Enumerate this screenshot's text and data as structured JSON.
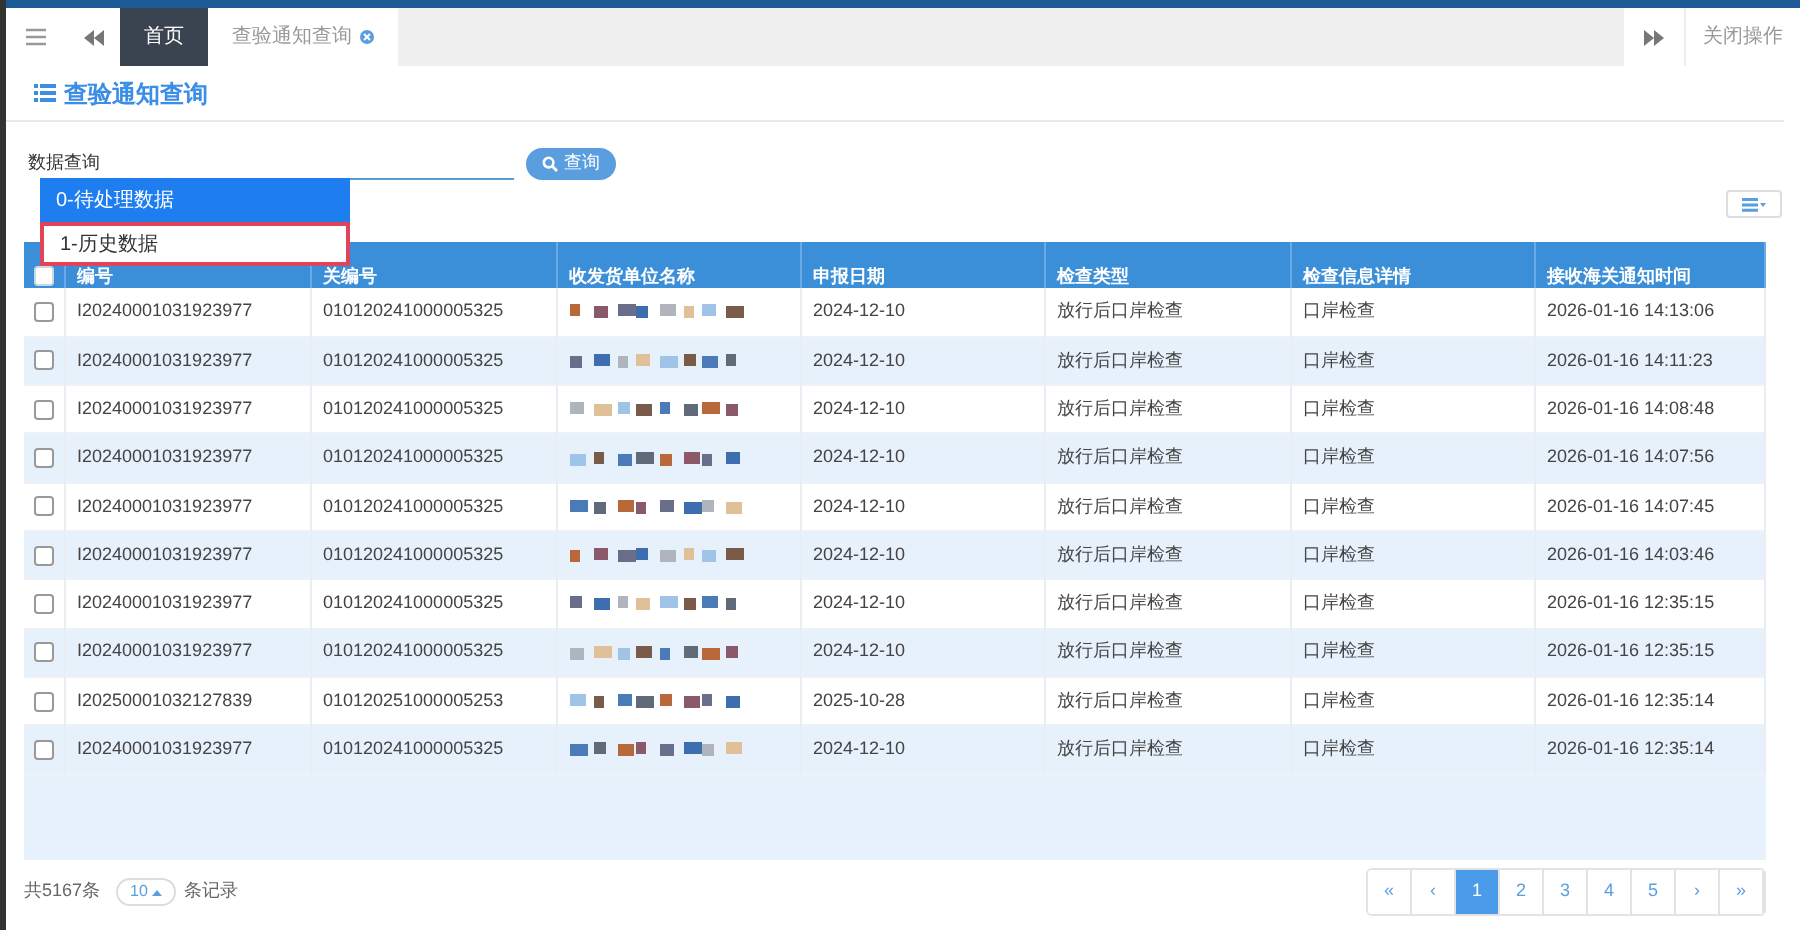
{
  "tabs": [
    {
      "label": "首页",
      "selected": true,
      "closable": false
    },
    {
      "label": "查验通知查询",
      "selected": false,
      "closable": true
    }
  ],
  "close_actions": "关闭操作",
  "page_title": "查验通知查询",
  "query": {
    "label": "数据查询",
    "button": "查询"
  },
  "dropdown": [
    {
      "label": "0-待处理数据",
      "selected": true,
      "highlighted": false
    },
    {
      "label": "1-历史数据",
      "selected": false,
      "highlighted": true
    }
  ],
  "table": {
    "all_checked": false,
    "columns": [
      "编号",
      "关编号",
      "收发货单位名称",
      "申报日期",
      "检查类型",
      "检查信息详情",
      "接收海关通知时间"
    ],
    "rows": [
      {
        "id": "I20240001031923977",
        "customs_no": "010120241000005325",
        "date": "2024-12-10",
        "check_type": "放行后口岸检查",
        "detail": "口岸检查",
        "received": "2026-01-16 14:13:06",
        "checked": false
      },
      {
        "id": "I20240001031923977",
        "customs_no": "010120241000005325",
        "date": "2024-12-10",
        "check_type": "放行后口岸检查",
        "detail": "口岸检查",
        "received": "2026-01-16 14:11:23",
        "checked": false
      },
      {
        "id": "I20240001031923977",
        "customs_no": "010120241000005325",
        "date": "2024-12-10",
        "check_type": "放行后口岸检查",
        "detail": "口岸检查",
        "received": "2026-01-16 14:08:48",
        "checked": false
      },
      {
        "id": "I20240001031923977",
        "customs_no": "010120241000005325",
        "date": "2024-12-10",
        "check_type": "放行后口岸检查",
        "detail": "口岸检查",
        "received": "2026-01-16 14:07:56",
        "checked": false
      },
      {
        "id": "I20240001031923977",
        "customs_no": "010120241000005325",
        "date": "2024-12-10",
        "check_type": "放行后口岸检查",
        "detail": "口岸检查",
        "received": "2026-01-16 14:07:45",
        "checked": false
      },
      {
        "id": "I20240001031923977",
        "customs_no": "010120241000005325",
        "date": "2024-12-10",
        "check_type": "放行后口岸检查",
        "detail": "口岸检查",
        "received": "2026-01-16 14:03:46",
        "checked": false
      },
      {
        "id": "I20240001031923977",
        "customs_no": "010120241000005325",
        "date": "2024-12-10",
        "check_type": "放行后口岸检查",
        "detail": "口岸检查",
        "received": "2026-01-16 12:35:15",
        "checked": false
      },
      {
        "id": "I20240001031923977",
        "customs_no": "010120241000005325",
        "date": "2024-12-10",
        "check_type": "放行后口岸检查",
        "detail": "口岸检查",
        "received": "2026-01-16 12:35:15",
        "checked": false
      },
      {
        "id": "I20250001032127839",
        "customs_no": "010120251000005253",
        "date": "2025-10-28",
        "check_type": "放行后口岸检查",
        "detail": "口岸检查",
        "received": "2026-01-16 12:35:14",
        "checked": false
      },
      {
        "id": "I20240001031923977",
        "customs_no": "010120241000005325",
        "date": "2024-12-10",
        "check_type": "放行后口岸检查",
        "detail": "口岸检查",
        "received": "2026-01-16 12:35:14",
        "checked": false
      }
    ]
  },
  "footer": {
    "total": "共5167条",
    "page_size": "10",
    "suffix": "条记录"
  },
  "pagination": [
    {
      "label": "«",
      "selected": false
    },
    {
      "label": "‹",
      "selected": false
    },
    {
      "label": "1",
      "selected": true
    },
    {
      "label": "2",
      "selected": false
    },
    {
      "label": "3",
      "selected": false
    },
    {
      "label": "4",
      "selected": false
    },
    {
      "label": "5",
      "selected": false
    },
    {
      "label": "›",
      "selected": false
    },
    {
      "label": "»",
      "selected": false
    }
  ]
}
